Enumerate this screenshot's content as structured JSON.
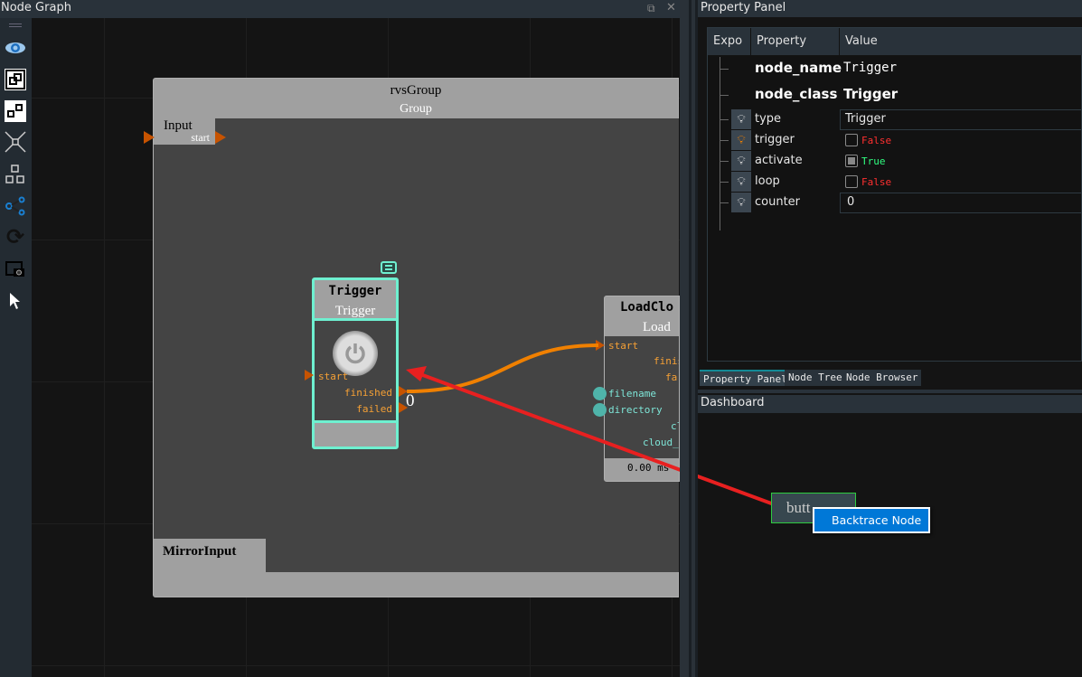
{
  "node_graph": {
    "title": "Node Graph",
    "toolbar": [
      "drag-handle",
      "eye-icon",
      "group-icon",
      "ungroup-icon",
      "collapse-icon",
      "layout-icon",
      "share-icon",
      "refresh-icon",
      "screenshot-icon",
      "pointer-icon"
    ],
    "group": {
      "name": "rvsGroup",
      "class": "Group",
      "input_label": "Input",
      "input_port": "start",
      "mirror_label": "MirrorInput"
    },
    "trigger_node": {
      "name": "Trigger",
      "class": "Trigger",
      "ports_in": [
        "start"
      ],
      "ports_out": [
        "finished",
        "failed"
      ],
      "counter_label": "0"
    },
    "load_node": {
      "name": "LoadClo",
      "class": "Load",
      "ports": [
        "start",
        "finis",
        "fa",
        "filename",
        "directory",
        "cl",
        "cloud_l"
      ],
      "footer": "0.00 ms"
    }
  },
  "property_panel": {
    "title": "Property Panel",
    "columns": [
      "Expo",
      "Property",
      "Value"
    ],
    "rows": [
      {
        "property": "node_name",
        "value": "Trigger"
      },
      {
        "property": "node_class",
        "value": "Trigger"
      },
      {
        "property": "type",
        "value": "Trigger",
        "exposed": false
      },
      {
        "property": "trigger",
        "value": "False",
        "checked": false,
        "exposed": true
      },
      {
        "property": "activate",
        "value": "True",
        "checked": true,
        "exposed": false
      },
      {
        "property": "loop",
        "value": "False",
        "checked": false,
        "exposed": false
      },
      {
        "property": "counter",
        "value": "0",
        "exposed": false
      }
    ],
    "tabs": [
      "Property Panel",
      "Node Tree",
      "Node Browser"
    ],
    "active_tab": "Property Panel"
  },
  "dashboard": {
    "title": "Dashboard",
    "button_label": "butt",
    "context_menu": [
      "Backtrace Node"
    ]
  },
  "colors": {
    "accent": "#6ef0d0",
    "exec_port": "#c75300",
    "link": "#f08000",
    "annotation_arrow": "#e82020",
    "false": "#ff3030",
    "true": "#30ff80",
    "menu": "#0078d7"
  }
}
